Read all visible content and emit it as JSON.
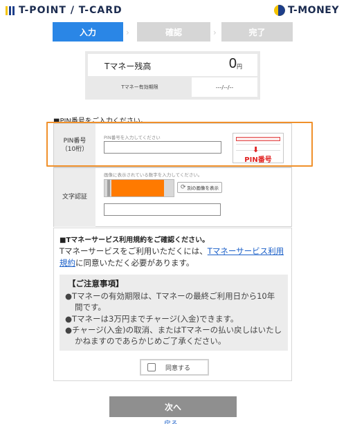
{
  "header": {
    "brand_left": "T-POINT / T-CARD",
    "brand_right": "T-MONEY"
  },
  "steps": [
    {
      "label": "入力",
      "state": "active"
    },
    {
      "label": "確認",
      "state": "inactive"
    },
    {
      "label": "完了",
      "state": "inactive"
    }
  ],
  "balance": {
    "label": "Tマネー残高",
    "value": "0",
    "unit": "円",
    "expiry_label": "Tマネー有効期限",
    "expiry_value": "---/--/--"
  },
  "pin_section": {
    "prompt": "■PIN番号をご入力ください。",
    "pin_label_line1": "PIN番号",
    "pin_label_line2": "（10桁）",
    "pin_hint": "PIN番号を入力してください",
    "pin_placeholder": "",
    "pin_card_label": "PIN番号"
  },
  "captcha": {
    "label": "文字認証",
    "hint": "画像に表示されている数字を入力してください。",
    "refresh_label": "別の画像を表示",
    "input_placeholder": ""
  },
  "terms": {
    "title": "■Tマネーサービス利用規約をご確認ください。",
    "text_before": "Tマネーサービスをご利用いただくには、",
    "link_text": "Tマネーサービス利用規約",
    "text_after": "に同意いただく必要があります。",
    "notice_title": "【ご注意事項】",
    "notice_items": [
      "●Tマネーの有効期限は、Tマネーの最終ご利用日から10年間です。",
      "●Tマネーは3万円までチャージ(入金)できます。",
      "●チャージ(入金)の取消、またはTマネーの払い戻しはいたしかねますのであらかじめご了承ください。"
    ],
    "agree_label": "同意する"
  },
  "actions": {
    "next_label": "次へ",
    "back_label": "戻る"
  },
  "colors": {
    "accent": "#2a86e6",
    "highlight": "#f0902a",
    "link": "#1a5fc8",
    "error": "#e02020"
  }
}
